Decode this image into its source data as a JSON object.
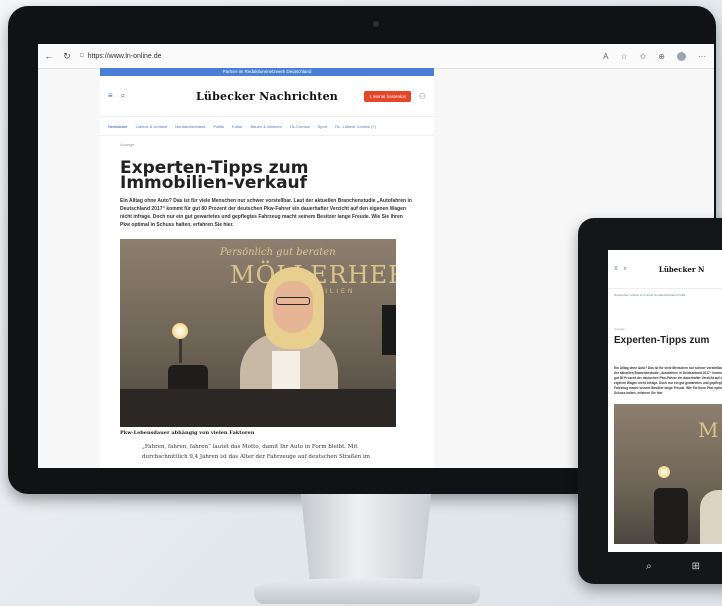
{
  "desktop": {
    "browser": {
      "url": "https://www.ln-online.de",
      "back_icon": "←",
      "reload_icon": "↻"
    },
    "site": {
      "banner": "Partner im Redaktionsnetzwerk Deutschland",
      "logo": "Lübecker Nachrichten",
      "subscribe_button": "1 Monat kostenlos",
      "nav_items": [
        "Newsticker",
        "Lübeck & Umland",
        "Norddeutschland",
        "Politik",
        "Kultur",
        "Bauen & Wohnen",
        "HL-Comics",
        "Sport",
        "HL: Lübeck Comics (+)"
      ],
      "ad_label": "Anzeige",
      "headline": "Experten-Tipps zum Immobilien-verkauf",
      "lead": "Ein Alltag ohne Auto? Das ist für viele Menschen nur schwer vorstellbar. Laut der aktuellen Branchenstudie „Autofahren in Deutschland 2017“ kommt für gut 80 Prozent der deutschen Pkw-Fahrer ein dauerhafter Verzicht auf den eigenen Wagen nicht infrage. Doch nur ein gut gewartetes und gepflegtes Fahrzeug macht seinem Besitzer lange Freude. Wie Sie Ihren Pkw optimal in Schuss halten, erfahren Sie hier.",
      "photo_script": "Persönlich gut beraten",
      "photo_brand": "MÖLLERHERM",
      "photo_brand_sub": "IMMOBILIEN",
      "caption": "Pkw-Lebensdauer abhängig von vielen Faktoren",
      "body": "„Fahren, fahren, fahren“ lautet das Motto, damit Ihr Auto in Form bleibt. Mit durchschnittlich 9,4 Jahren ist das Alter der Fahrzeuge auf deutschen Straßen im"
    }
  },
  "tablet": {
    "logo": "Lübecker N",
    "nav": "Newsticker   Lübeck & Umland   Norddeutschland   Politik",
    "ad_label": "Anzeige",
    "headline": "Experten-Tipps zum",
    "lead": "Ein Alltag ohne Auto? Das ist für viele Menschen nur schwer vorstellbar. Laut der aktuellen Branchenstudie „Autofahren in Deutschland 2017“ kommt für gut 80 Prozent der deutschen Pkw-Fahrer ein dauerhafter Verzicht auf den eigenen Wagen nicht infrage. Doch nur ein gut gewartetes und gepflegtes Fahrzeug macht seinem Besitzer lange Freude. Wie Sie Ihren Pkw optimal in Schuss halten, erfahren Sie hier.",
    "photo_brand": "M",
    "search_icon": "⌕"
  }
}
